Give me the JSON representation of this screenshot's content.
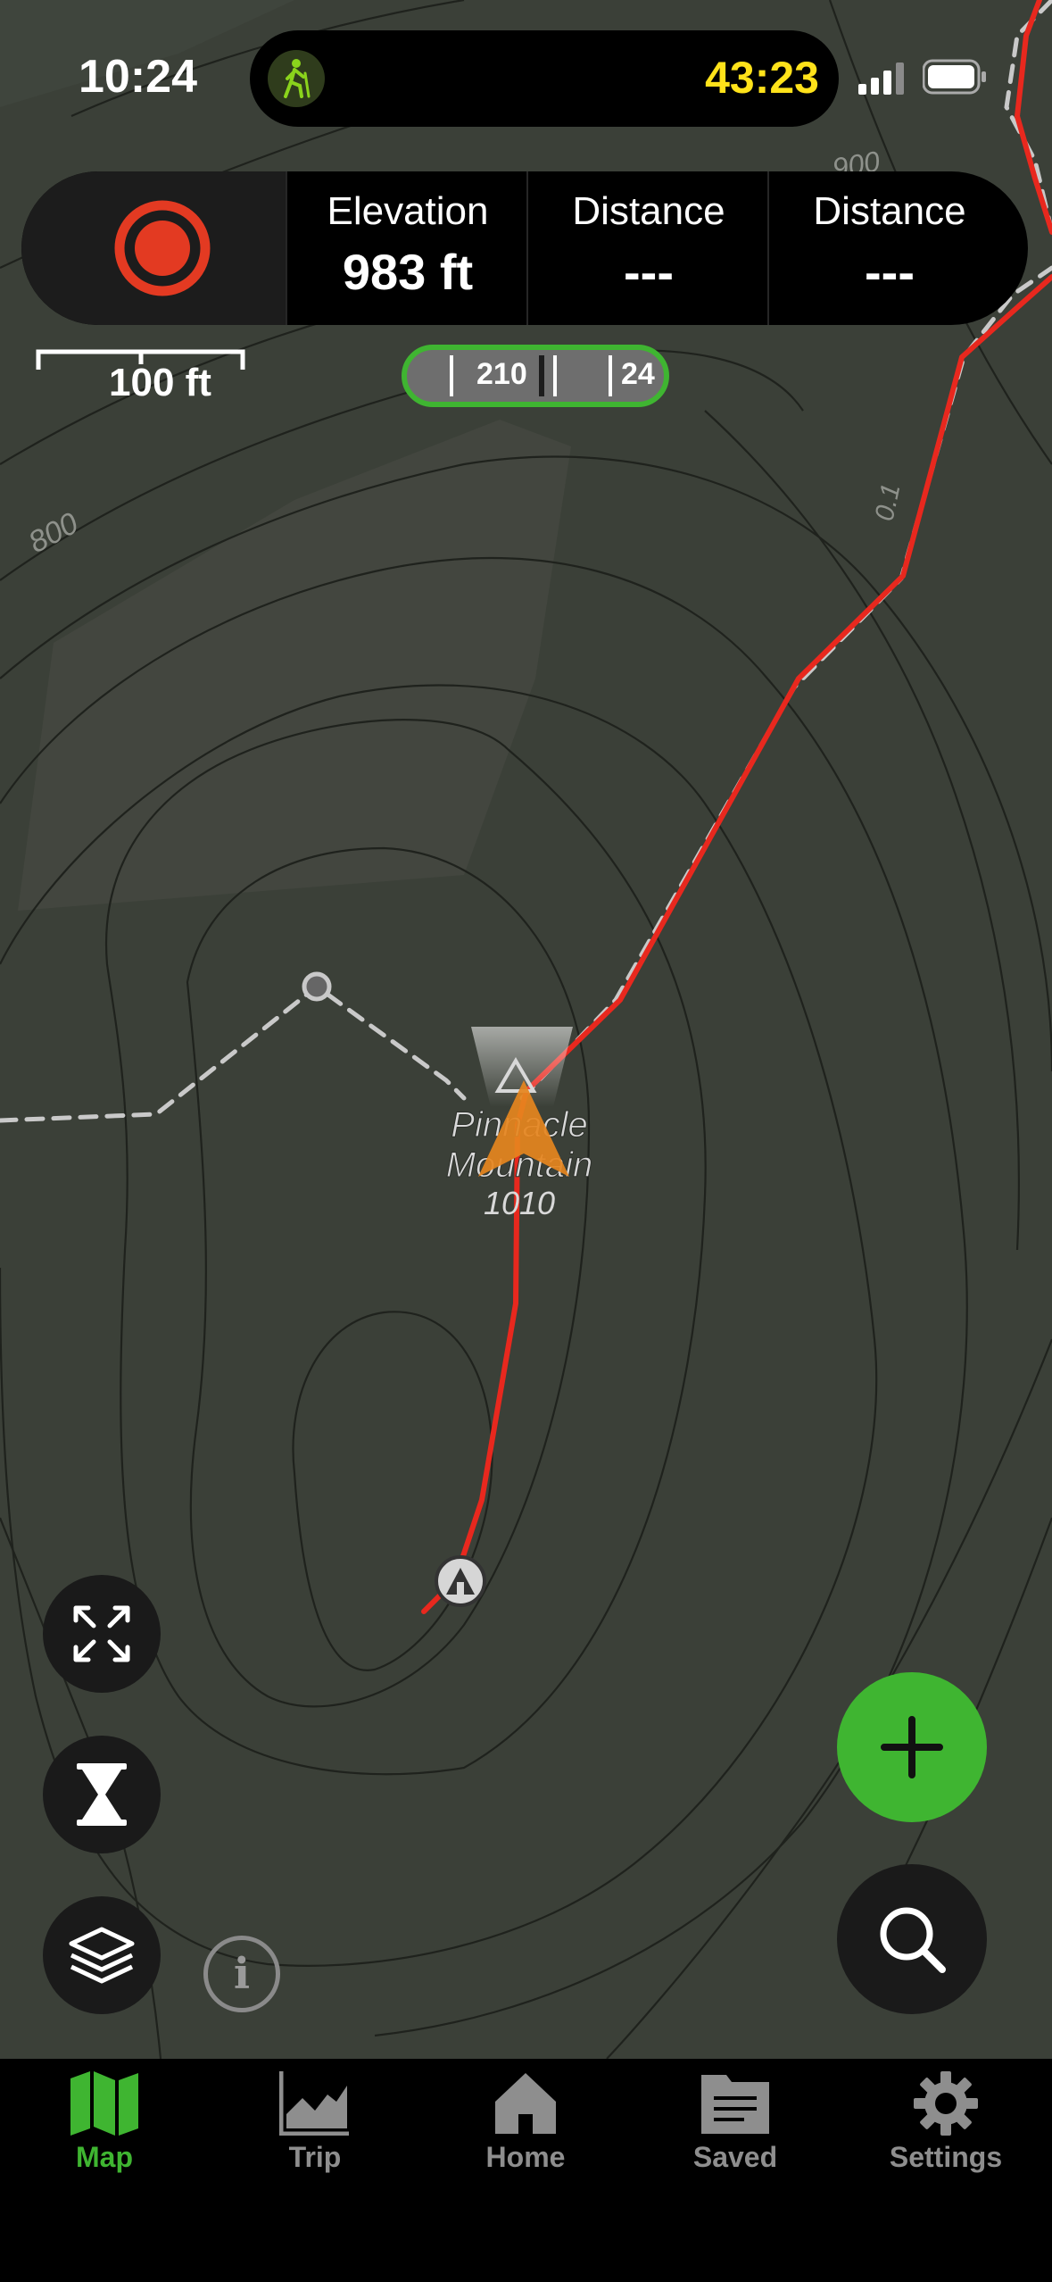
{
  "status_bar": {
    "time": "10:24",
    "activity_icon": "hiker-icon",
    "timer": "43:23",
    "timer_color": "#ffe21a"
  },
  "stats": {
    "record_icon": "record-icon",
    "items": [
      {
        "label": "Elevation",
        "value": "983 ft"
      },
      {
        "label": "Distance",
        "value": "---"
      },
      {
        "label": "Distance",
        "value": "---"
      }
    ]
  },
  "map": {
    "scale_label": "100 ft",
    "compass_labels": [
      "210",
      "24"
    ],
    "peak_name_line1": "Pinnacle",
    "peak_name_line2": "Mountain",
    "peak_elevation": "1010",
    "contour_labels": [
      "800",
      "0.1",
      "900"
    ],
    "route_color": "#e8281e",
    "trail_color": "#c9c9c9"
  },
  "controls": {
    "fullscreen_icon": "expand-icon",
    "hourglass_icon": "hourglass-icon",
    "layers_icon": "layers-icon",
    "info_icon": "i",
    "add_icon": "plus-icon",
    "search_icon": "search-icon",
    "accent": "#3fb531"
  },
  "tabs": [
    {
      "label": "Map",
      "icon": "map-icon",
      "active": true
    },
    {
      "label": "Trip",
      "icon": "chart-icon",
      "active": false
    },
    {
      "label": "Home",
      "icon": "home-icon",
      "active": false
    },
    {
      "label": "Saved",
      "icon": "saved-icon",
      "active": false
    },
    {
      "label": "Settings",
      "icon": "gear-icon",
      "active": false
    }
  ]
}
